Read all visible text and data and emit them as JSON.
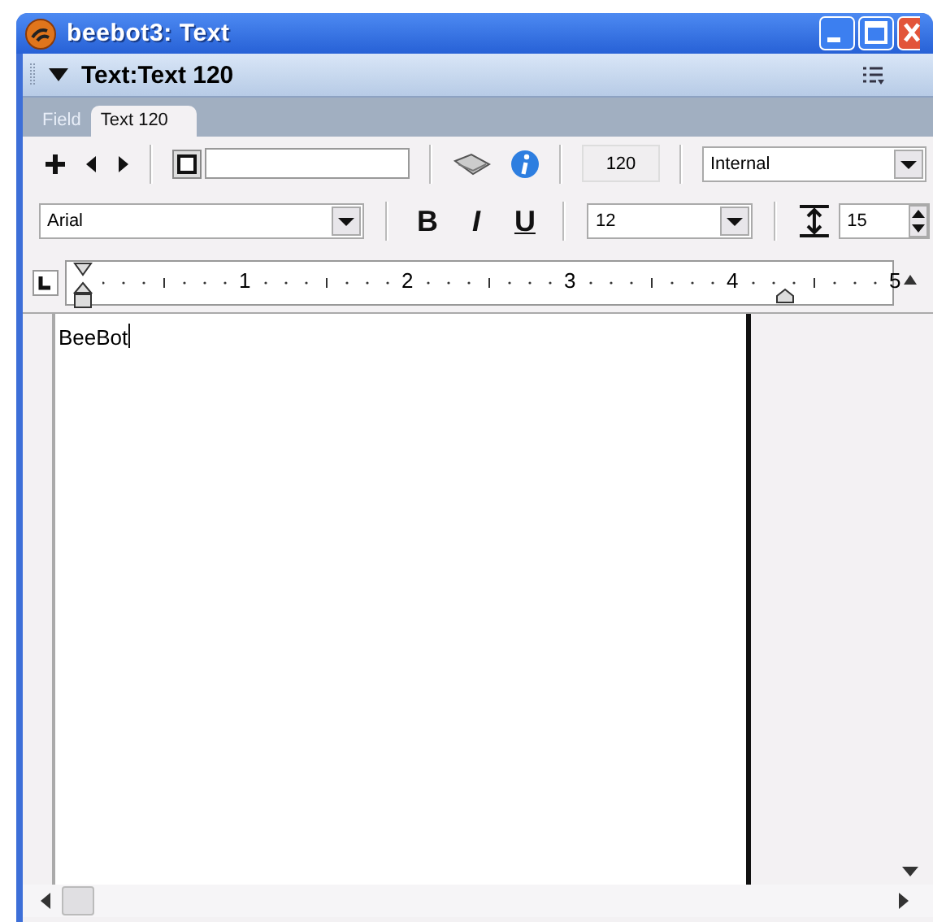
{
  "window": {
    "title": "beebot3: Text"
  },
  "panel": {
    "title": "Text:Text 120"
  },
  "tabs": [
    {
      "label": "Field",
      "selected": false
    },
    {
      "label": "Text 120",
      "selected": true
    }
  ],
  "toolbar": {
    "member_number": "120",
    "storage": "Internal",
    "font": "Arial",
    "style_buttons": [
      "B",
      "I",
      "U"
    ],
    "size": "12",
    "line_spacing": "15"
  },
  "ruler": {
    "labels": [
      "1",
      "2",
      "3",
      "4",
      "5"
    ]
  },
  "document": {
    "text": "BeeBot"
  }
}
